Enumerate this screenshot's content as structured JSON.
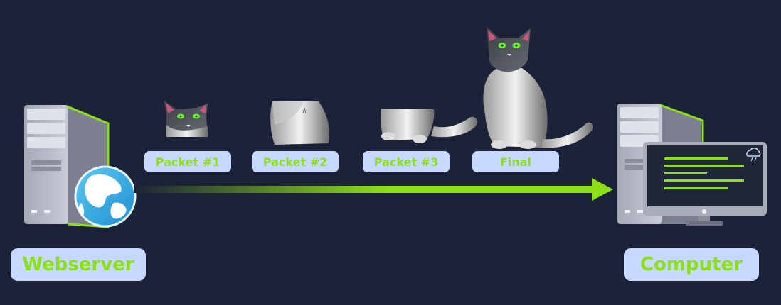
{
  "labels": {
    "webserver": "Webserver",
    "computer": "Computer",
    "packet1": "Packet #1",
    "packet2": "Packet #2",
    "packet3": "Packet #3",
    "final": "Final"
  },
  "colors": {
    "background": "#1c2237",
    "label_bg": "#c7d8ff",
    "accent_green": "#8be016",
    "server_body": "#b9bcc8",
    "monitor_screen": "#1e2638"
  },
  "icons": [
    "server-tower-icon",
    "globe-icon",
    "arrow-icon",
    "monitor-icon",
    "cloud-icon",
    "cat-image"
  ]
}
